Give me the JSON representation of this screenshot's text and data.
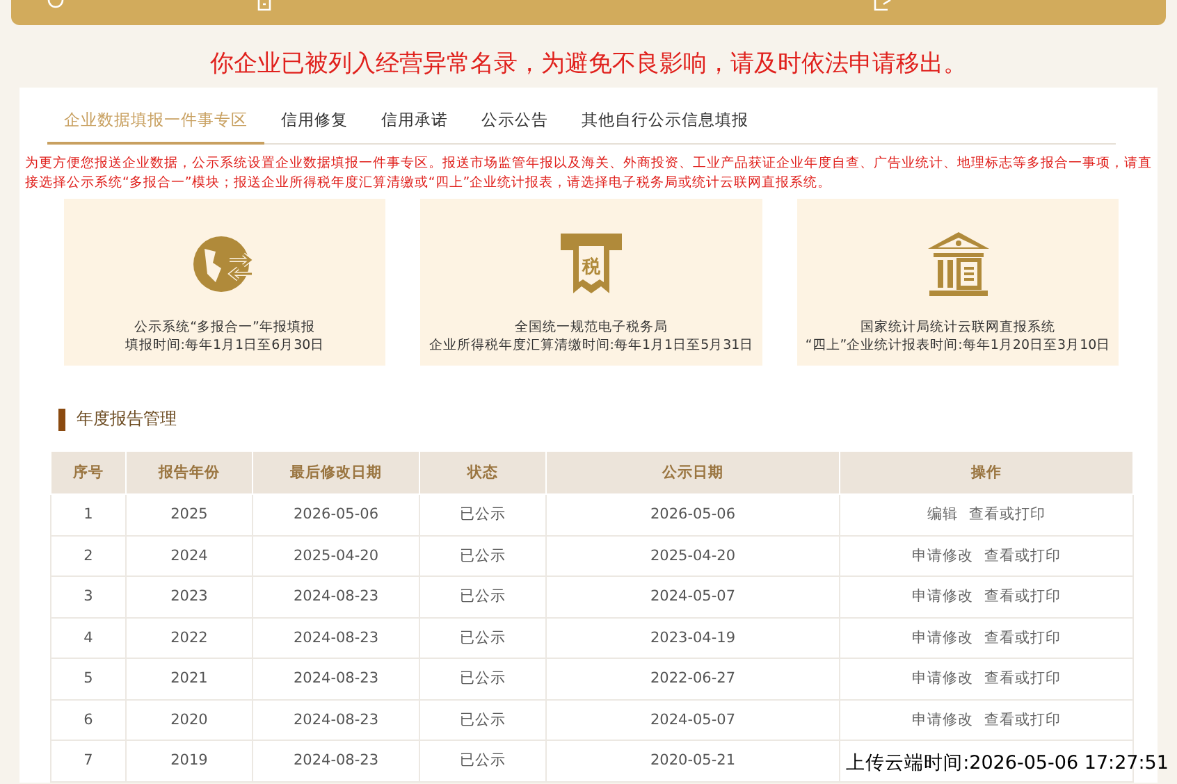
{
  "alert": "你企业已被列入经营异常名录，为避免不良影响，请及时依法申请移出。",
  "tabs": [
    {
      "label": "企业数据填报一件事专区",
      "selected": true
    },
    {
      "label": "信用修复",
      "selected": false
    },
    {
      "label": "信用承诺",
      "selected": false
    },
    {
      "label": "公示公告",
      "selected": false
    },
    {
      "label": "其他自行公示信息填报",
      "selected": false
    }
  ],
  "notice": "为更方便您报送企业数据，公示系统设置企业数据填报一件事专区。报送市场监管年报以及海关、外商投资、工业产品获证企业年度自查、广告业统计、地理标志等多报合一事项，请直接选择公示系统“多报合一”模块；报送企业所得税年度汇算清缴或“四上”企业统计报表，请选择电子税务局或统计云联网直报系统。",
  "cards": [
    {
      "kind": "globe",
      "title": "公示系统“多报合一”年报填报",
      "period": "填报时间:每年1月1日至6月30日"
    },
    {
      "kind": "tax",
      "icon_text": "税",
      "title": "全国统一规范电子税务局",
      "period": "企业所得税年度汇算清缴时间:每年1月1日至5月31日"
    },
    {
      "kind": "bank",
      "title": "国家统计局统计云联网直报系统",
      "period": "“四上”企业统计报表时间:每年1月20日至3月10日"
    }
  ],
  "section_title": "年度报告管理",
  "table": {
    "columns": [
      "序号",
      "报告年份",
      "最后修改日期",
      "状态",
      "公示日期",
      "操作"
    ],
    "rows": [
      {
        "cells": [
          "1",
          "2025",
          "2026-05-06",
          "已公示",
          "2026-05-06"
        ],
        "actions": [
          "编辑",
          "查看或打印"
        ]
      },
      {
        "cells": [
          "2",
          "2024",
          "2025-04-20",
          "已公示",
          "2025-04-20"
        ],
        "actions": [
          "申请修改",
          "查看或打印"
        ]
      },
      {
        "cells": [
          "3",
          "2023",
          "2024-08-23",
          "已公示",
          "2024-05-07"
        ],
        "actions": [
          "申请修改",
          "查看或打印"
        ]
      },
      {
        "cells": [
          "4",
          "2022",
          "2024-08-23",
          "已公示",
          "2023-04-19"
        ],
        "actions": [
          "申请修改",
          "查看或打印"
        ]
      },
      {
        "cells": [
          "5",
          "2021",
          "2024-08-23",
          "已公示",
          "2022-06-27"
        ],
        "actions": [
          "申请修改",
          "查看或打印"
        ]
      },
      {
        "cells": [
          "6",
          "2020",
          "2024-08-23",
          "已公示",
          "2024-05-07"
        ],
        "actions": [
          "申请修改",
          "查看或打印"
        ]
      },
      {
        "cells": [
          "7",
          "2019",
          "2024-08-23",
          "已公示",
          "2020-05-21"
        ],
        "actions": []
      }
    ]
  },
  "overlay_timestamp": "上传云端时间:2026-05-06 17:27:51"
}
